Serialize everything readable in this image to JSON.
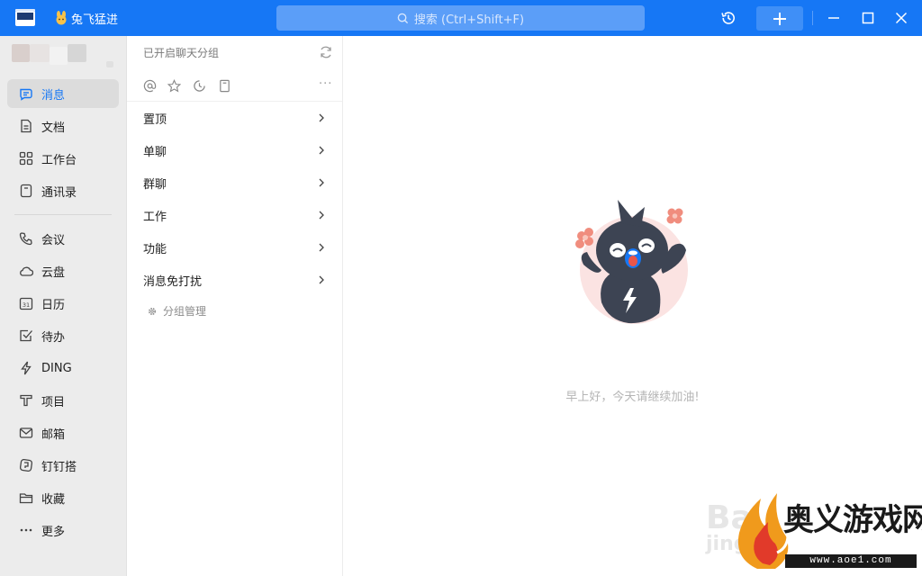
{
  "titlebar": {
    "team_name": "兔飞猛进",
    "search_placeholder": "搜索 (Ctrl+Shift+F)",
    "history_icon": "history-icon",
    "add_icon": "plus-icon",
    "window_controls": [
      "minimize-icon",
      "maximize-icon",
      "close-icon"
    ],
    "accent": "#1677f5"
  },
  "nav": {
    "items": [
      {
        "label": "消息",
        "icon": "message-icon",
        "active": true
      },
      {
        "label": "文档",
        "icon": "document-icon"
      },
      {
        "label": "工作台",
        "icon": "grid-icon"
      },
      {
        "label": "通讯录",
        "icon": "contacts-icon"
      },
      {
        "label": "会议",
        "icon": "phone-icon"
      },
      {
        "label": "云盘",
        "icon": "cloud-icon"
      },
      {
        "label": "日历",
        "icon": "calendar-icon"
      },
      {
        "label": "待办",
        "icon": "todo-icon"
      },
      {
        "label": "DING",
        "icon": "lightning-icon"
      },
      {
        "label": "项目",
        "icon": "project-icon"
      },
      {
        "label": "邮箱",
        "icon": "mail-icon"
      },
      {
        "label": "钉钉搭",
        "icon": "build-icon"
      },
      {
        "label": "收藏",
        "icon": "folder-icon"
      },
      {
        "label": "更多",
        "icon": "more-icon"
      }
    ]
  },
  "groups": {
    "title": "已开启聊天分组",
    "quick_icons": [
      "at-icon",
      "star-icon",
      "clock-icon",
      "bookmark-icon",
      "more-icon"
    ],
    "items": [
      {
        "label": "置顶"
      },
      {
        "label": "单聊"
      },
      {
        "label": "群聊"
      },
      {
        "label": "工作"
      },
      {
        "label": "功能"
      },
      {
        "label": "消息免打扰"
      }
    ],
    "manage_label": "分组管理"
  },
  "main": {
    "greeting": "早上好，今天请继续加油!"
  },
  "watermark": {
    "brand": "奥义游戏网",
    "url": "www.aoe1.com",
    "baidu": "Ba",
    "jing": "jing"
  }
}
